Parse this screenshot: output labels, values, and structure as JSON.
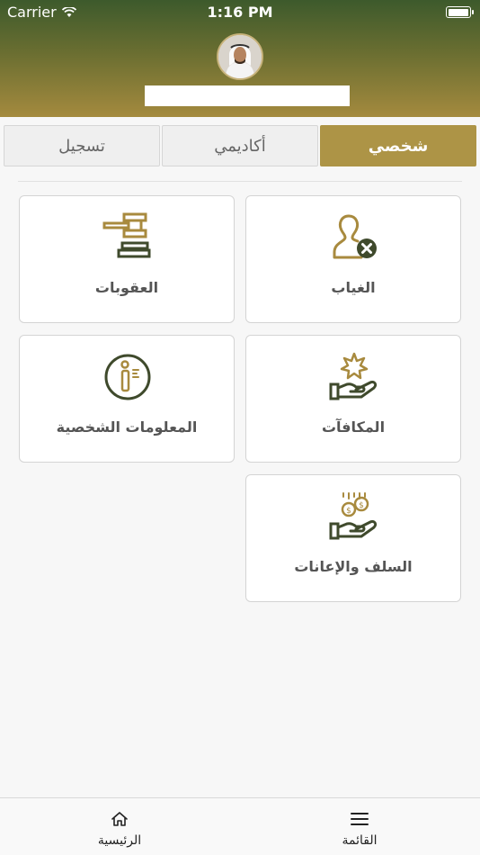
{
  "status_bar": {
    "carrier": "Carrier",
    "time": "1:16 PM"
  },
  "tabs": [
    {
      "label": "شخصي",
      "active": true
    },
    {
      "label": "أكاديمي",
      "active": false
    },
    {
      "label": "تسجيل",
      "active": false
    }
  ],
  "cards": {
    "absence": {
      "label": "الغياب",
      "icon": "person-remove-icon"
    },
    "penalties": {
      "label": "العقوبات",
      "icon": "gavel-icon"
    },
    "rewards": {
      "label": "المكافآت",
      "icon": "hand-star-icon"
    },
    "personal_info": {
      "label": "المعلومات الشخصية",
      "icon": "info-icon"
    },
    "loans": {
      "label": "السلف والإعانات",
      "icon": "hand-coins-icon"
    }
  },
  "bottom_nav": {
    "menu_label": "القائمة",
    "home_label": "الرئيسية"
  },
  "colors": {
    "accent": "#ad9446",
    "icon_dark": "#3f4a2c",
    "icon_gold": "#a88a3e"
  }
}
